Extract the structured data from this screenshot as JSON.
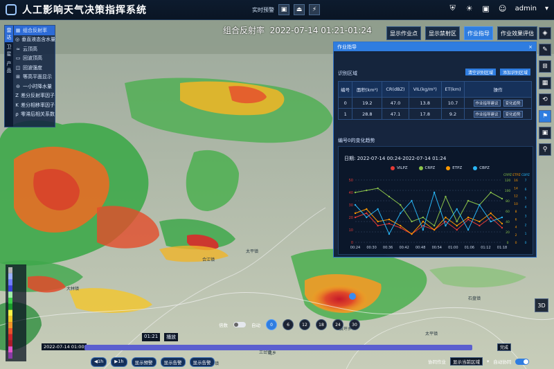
{
  "app": {
    "title": "人工影响天气决策指挥系统"
  },
  "top_center": {
    "label": "实时预警",
    "icons": [
      "▣",
      "⏏",
      "⚡"
    ]
  },
  "user": {
    "name": "admin",
    "dropdown": "▾"
  },
  "left_menu": {
    "tabs": [
      "雷达",
      "卫星",
      "产品"
    ],
    "items": [
      {
        "icon": "▦",
        "label": "组合反射率",
        "active": true
      },
      {
        "icon": "◎",
        "label": "垂直液态含水量"
      },
      {
        "icon": "≈",
        "label": "云顶高"
      },
      {
        "icon": "▭",
        "label": "回波顶高"
      },
      {
        "icon": "◫",
        "label": "回波强度"
      },
      {
        "icon": "⊞",
        "label": "等高平面显示"
      },
      {
        "icon": "⊖",
        "label": "一小时降水量"
      },
      {
        "icon": "Z",
        "label": "差分反射率因子"
      },
      {
        "icon": "K",
        "label": "差分相移率因子"
      },
      {
        "icon": "ρ",
        "label": "零滞后相关系数"
      }
    ]
  },
  "map_title": {
    "product": "组合反射率",
    "time": "2022-07-14 01:21-01:24"
  },
  "toolbar": [
    "显示作业点",
    "显示禁射区",
    "作业指导",
    "作业效果评估"
  ],
  "right_tools": [
    "◈",
    "✎",
    "⊞",
    "▦",
    "⟲",
    "⚑",
    "▣",
    "⚲"
  ],
  "btn_3d": "3D",
  "panel": {
    "title": "作业指导",
    "close": "×",
    "section1": "识别区域",
    "btn_clear": "清空识别区域",
    "btn_add": "添加识别区域",
    "columns": [
      "编号",
      "面积(km²)",
      "CR(dBZ)",
      "VIL(kg/m²)",
      "ET(km)",
      "操作"
    ],
    "rows": [
      {
        "id": "0",
        "area": "19.2",
        "cr": "47.0",
        "vil": "13.8",
        "et": "10.7",
        "ops": [
          "作业指导建议",
          "变化趋势"
        ]
      },
      {
        "id": "1",
        "area": "28.8",
        "cr": "47.1",
        "vil": "17.8",
        "et": "9.2",
        "ops": [
          "作业指导建议",
          "变化趋势"
        ]
      }
    ],
    "section2": "编号0的变化趋势",
    "date_label": "日期:",
    "date_range": "2022-07-14 00:24-2022-07-14 01:24"
  },
  "chart_data": {
    "type": "line",
    "legend": [
      "VILPZ",
      "CRPZ",
      "ETPZ",
      "CBPZ"
    ],
    "colors": [
      "#e53935",
      "#8bc34a",
      "#ff9800",
      "#29b6f6"
    ],
    "x": [
      "00:24",
      "00:30",
      "00:36",
      "00:42",
      "00:48",
      "00:54",
      "01:00",
      "01:06",
      "01:12",
      "01:18"
    ],
    "axis_labels_right": [
      "CRPZ",
      "ETPZ",
      "CBPZ"
    ],
    "left_ticks": [
      "0",
      "10",
      "20",
      "30",
      "40",
      "50"
    ],
    "right_ticks1": [
      "0",
      "20",
      "40",
      "60",
      "80",
      "100",
      "120"
    ],
    "right_ticks2": [
      "0",
      "2",
      "4",
      "6",
      "8",
      "10",
      "12",
      "14",
      "16"
    ],
    "right_ticks3": [
      "0",
      "1",
      "2",
      "3",
      "4",
      "5",
      "6",
      "7"
    ],
    "series": [
      {
        "name": "VILPZ",
        "values": [
          12,
          14,
          8,
          9,
          7,
          4,
          8,
          6,
          10,
          6,
          11,
          8,
          12,
          7
        ]
      },
      {
        "name": "CRPZ",
        "values": [
          24,
          25,
          26,
          22,
          18,
          10,
          12,
          8,
          22,
          10,
          20,
          18,
          24,
          21
        ]
      },
      {
        "name": "ETPZ",
        "values": [
          14,
          16,
          10,
          11,
          8,
          4,
          10,
          6,
          12,
          8,
          12,
          10,
          14,
          9
        ]
      },
      {
        "name": "CBPZ",
        "values": [
          18,
          12,
          16,
          4,
          14,
          20,
          6,
          24,
          8,
          16,
          6,
          18,
          10,
          12
        ]
      }
    ]
  },
  "speed": {
    "label": "倍数",
    "toggle": "自动",
    "options": [
      "0",
      "6",
      "12",
      "18",
      "24",
      "30"
    ]
  },
  "timeline": {
    "start": "2022-07-14 01:00",
    "current": "01:21",
    "status": "播放",
    "btn_done": "完成"
  },
  "bottom_btns": [
    "◀1h",
    "▶1h",
    "显示预警",
    "显示告警",
    "显示告警"
  ],
  "bottom_right": {
    "label": "协同作业",
    "select": "显示当前区域",
    "toggle_label": "自动协同"
  },
  "map_labels": [
    {
      "t": "太平镇",
      "x": 355,
      "y": 358
    },
    {
      "t": "大林镇",
      "x": 96,
      "y": 412
    },
    {
      "t": "石盘镇",
      "x": 676,
      "y": 426
    },
    {
      "t": "太平镇",
      "x": 614,
      "y": 477
    },
    {
      "t": "三岔镇",
      "x": 298,
      "y": 520
    },
    {
      "t": "三岔镇",
      "x": 374,
      "y": 504
    },
    {
      "t": "合江镇",
      "x": 292,
      "y": 370
    },
    {
      "t": "黄坪乡",
      "x": 490,
      "y": 470
    },
    {
      "t": "北乡",
      "x": 387,
      "y": 505
    }
  ]
}
